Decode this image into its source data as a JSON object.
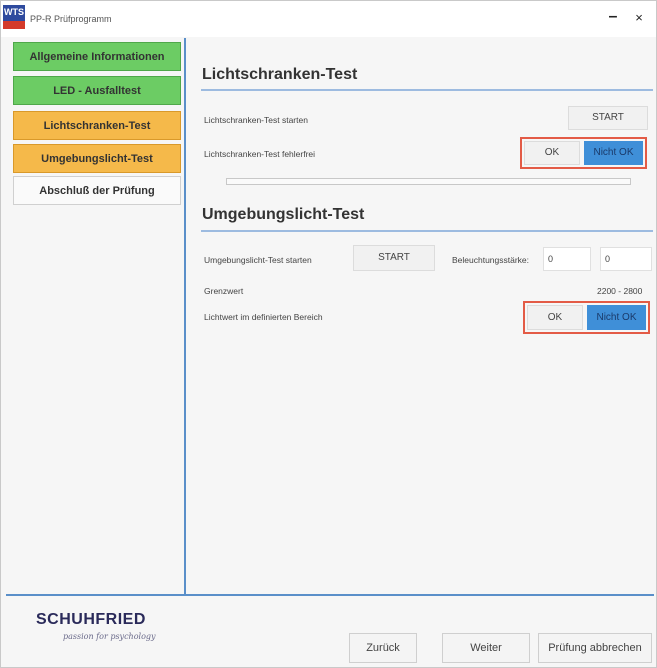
{
  "window": {
    "app_badge": "WTS",
    "title": "PP-R Prüfprogramm",
    "minimize_glyph": "–",
    "close_glyph": "×"
  },
  "sidebar": {
    "items": [
      {
        "label": "Allgemeine Informationen",
        "status": "green"
      },
      {
        "label": "LED - Ausfalltest",
        "status": "green"
      },
      {
        "label": "Lichtschranken-Test",
        "status": "orange"
      },
      {
        "label": "Umgebungslicht-Test",
        "status": "orange"
      },
      {
        "label": "Abschluß der Prüfung",
        "status": "neutral"
      }
    ]
  },
  "light_barrier": {
    "title": "Lichtschranken-Test",
    "start_label": "Lichtschranken-Test starten",
    "start_button": "START",
    "error_free_label": "Lichtschranken-Test fehlerfrei",
    "ok_button": "OK",
    "not_ok_button": "Nicht OK",
    "selected": "Nicht OK",
    "progress": 0
  },
  "ambient_light": {
    "title": "Umgebungslicht-Test",
    "start_label": "Umgebungslicht-Test starten",
    "start_button": "START",
    "illuminance_label": "Beleuchtungsstärke:",
    "illuminance_value_1": "0",
    "illuminance_value_2": "0",
    "limit_label": "Grenzwert",
    "limit_value": "2200 - 2800",
    "in_range_label": "Lichtwert im definierten Bereich",
    "ok_button": "OK",
    "not_ok_button": "Nicht OK",
    "selected": "Nicht OK"
  },
  "footer": {
    "brand": "SCHUHFRIED",
    "tagline": "passion for psychology",
    "back_button": "Zurück",
    "next_button": "Weiter",
    "abort_button": "Prüfung abbrechen"
  },
  "colors": {
    "accent_blue": "#5a8fc9",
    "status_green": "#6ccc64",
    "status_orange": "#f5b94a",
    "selected_blue": "#3f8fd8",
    "highlight_red": "#e35b46"
  }
}
